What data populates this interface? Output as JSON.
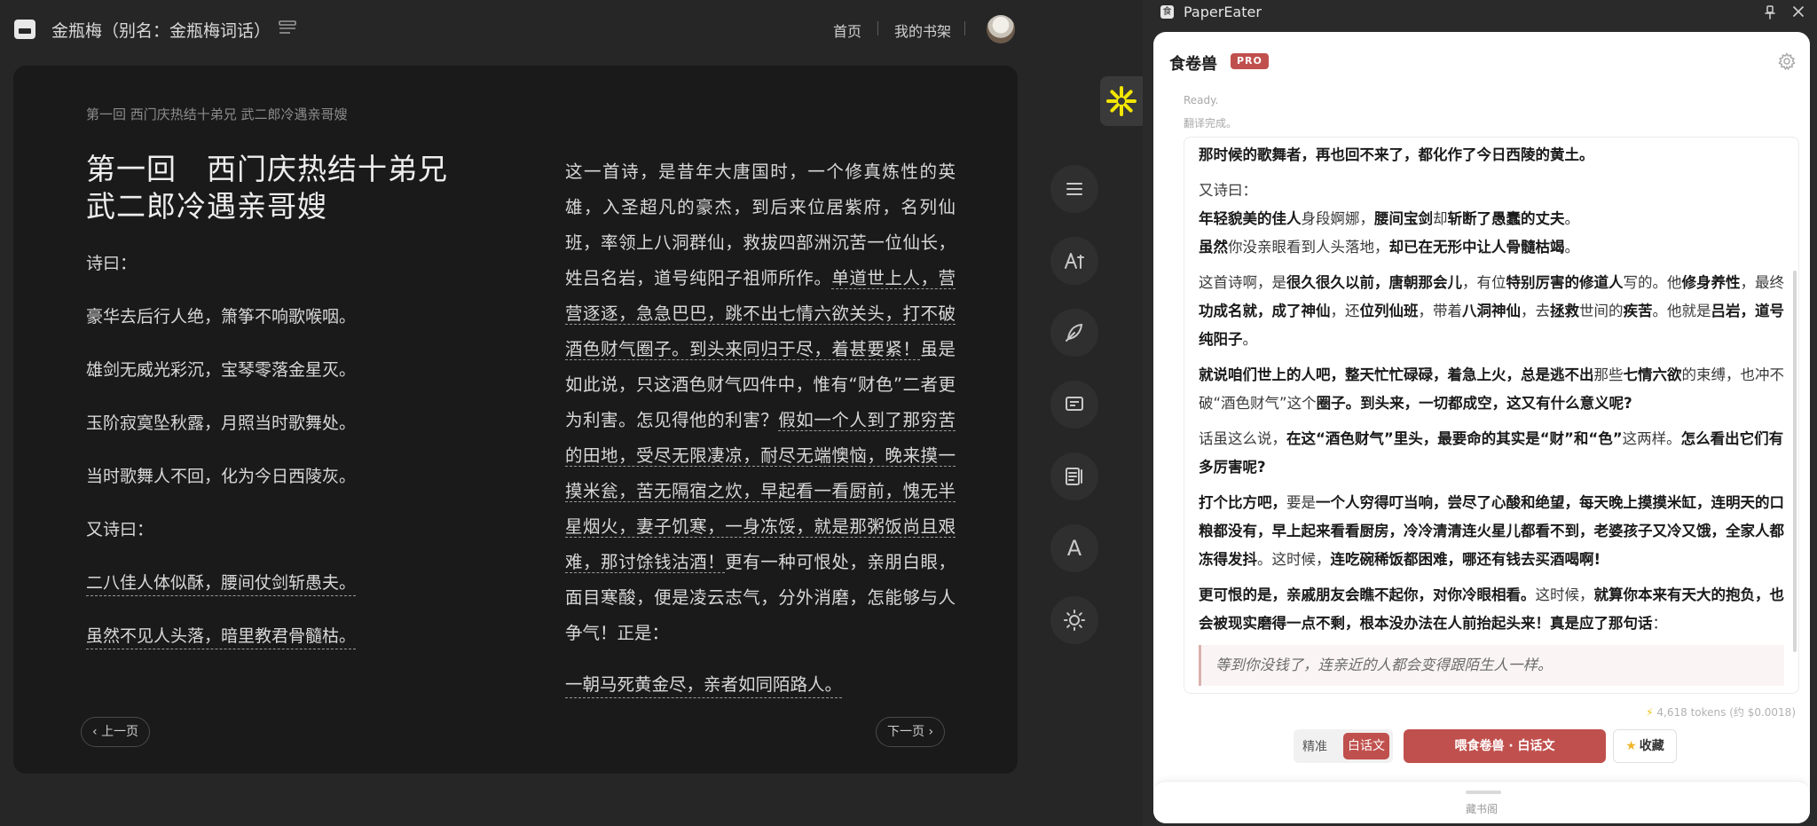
{
  "topbar": {
    "book_title": "金瓶梅（别名：金瓶梅词话）",
    "nav_home": "首页",
    "nav_shelf": "我的书架"
  },
  "reader": {
    "chapter_crumb": "第一回 西门庆热结十弟兄 武二郎冷遇亲哥嫂",
    "chapter_title_line1": "第一回　西门庆热结十弟兄",
    "chapter_title_line2": "武二郎冷遇亲哥嫂",
    "left_lines": [
      "诗曰：",
      "豪华去后行人绝，箫筝不响歌喉咽。",
      "雄剑无威光彩沉，宝琴零落金星灭。",
      "玉阶寂寞坠秋露，月照当时歌舞处。",
      "当时歌舞人不回，化为今日西陵灰。",
      "又诗曰：",
      "二八佳人体似酥，腰间仗剑斩愚夫。",
      "虽然不见人头落，暗里教君骨髓枯。"
    ],
    "right_text_a": "这一首诗，是昔年大唐国时，一个修真炼性的英雄，入圣超凡的豪杰，到后来位居紫府，名列仙班，率领上八洞群仙，救拔四部洲沉苦一位仙长，姓吕名岩，道号纯阳子祖师所作。",
    "right_text_b": "单道世上人，营营逐逐，急急巴巴，跳不出七情六欲关头，打不破酒色财气圈子。到头来同归于尽，着甚要紧！",
    "right_text_c": "虽是如此说，只这酒色财气四件中，惟有“财色”二者更为利害。怎见得他的利害？",
    "right_text_d": "假如一个人到了那穷苦的田地，受尽无限凄凉，耐尽无端懊恼，晚来摸一摸米瓮，苦无隔宿之炊，早起看一看厨前，愧无半星烟火，妻子饥寒，一身冻馁，就是那粥饭尚且艰难，那讨馀钱沽酒！",
    "right_text_e": "更有一种可恨处，亲朋白眼，面目寒酸，便是凌云志气，分外消磨，怎能够与人争气！正是：",
    "right_text_last": "一朝马死黄金尽，亲者如同陌路人。",
    "prev_page": "上一页",
    "next_page": "下一页"
  },
  "side_tools": {
    "font_glyph": "A"
  },
  "panel": {
    "app_name": "PaperEater",
    "logo_glyph": "食",
    "brand": "食卷兽",
    "pro_badge": "PRO",
    "status_ready": "Ready.",
    "status_done": "翻译完成。",
    "tokens": "4,618 tokens (约 $0.0018)",
    "mode_precise": "精准",
    "mode_vernacular": "白话文",
    "feed_button": "喂食卷兽 · 白话文",
    "favorite_button": "收藏",
    "drawer_label": "藏书阁",
    "output": {
      "p1": "那时候的歌舞者，再也回不来了，都化作了今日西陵的黄土。",
      "p2_a": "又诗曰：",
      "p2_b1": "年轻貌美的佳人",
      "p2_b2": "身段婀娜，",
      "p2_b3": "腰间宝剑",
      "p2_b4": "却",
      "p2_b5": "斩断了愚蠢的丈夫",
      "p2_b6": "。",
      "p2_c1": "虽然",
      "p2_c2": "你没亲眼看到人头落地，",
      "p2_c3": "却已在无形中让人骨髓枯竭",
      "p2_c4": "。",
      "p3_1": "这首诗啊，是",
      "p3_2": "很久很久以前，唐朝那会儿",
      "p3_3": "，有位",
      "p3_4": "特别厉害的修道人",
      "p3_5": "写的。他",
      "p3_6": "修身养性",
      "p3_7": "，最终",
      "p3_8": "功成名就，成了神仙",
      "p3_9": "，还",
      "p3_10": "位列仙班",
      "p3_11": "，带着",
      "p3_12": "八洞神仙",
      "p3_13": "，去",
      "p3_14": "拯救",
      "p3_15": "世间的",
      "p3_16": "疾苦",
      "p3_17": "。他就是",
      "p3_18": "吕岩，道号纯阳子",
      "p3_19": "。",
      "p4_1": "就说咱们世上的人吧，整天忙忙碌碌，着急上火，总是逃不出",
      "p4_2": "那些",
      "p4_3": "七情六欲",
      "p4_4": "的束缚，也冲不破“酒色财气”",
      "p4_5": "这个",
      "p4_6": "圈子。到头来，一切都成空，这又有什么意义呢?",
      "p5_1": "话虽这么说，",
      "p5_2": "在这“酒色财气”里头，最要命的其实是“财”和“色”",
      "p5_3": "这两样。",
      "p5_4": "怎么看出它们有多厉害呢?",
      "p6_1": "打个比方吧，",
      "p6_2": "要是",
      "p6_3": "一个人穷得叮当响，尝尽了心酸和绝望，每天晚上摸摸米缸，连明天的口粮都没有，早上起来看看厨房，冷冷清清连火星儿都看不到，老婆孩子又冷又饿，全家人都冻得发抖",
      "p6_4": "。这时候，",
      "p6_5": "连吃碗稀饭都困难，哪还有钱去买酒喝啊!",
      "p7_1": "更可恨的是，亲戚朋友会瞧不起你，对你冷眼相看。",
      "p7_2": "这时候，",
      "p7_3": "就算你本来有天大的抱负，也会被现实磨得一点不剩，根本没办法在人前抬起头来！真是应了那句话",
      "p7_4": "：",
      "quote": "等到你没钱了，连亲近的人都会变得跟陌生人一样。"
    }
  },
  "colors": {
    "accent": "#c0504d",
    "reader_bg": "#1a1a1a",
    "page_bg": "#262626"
  }
}
